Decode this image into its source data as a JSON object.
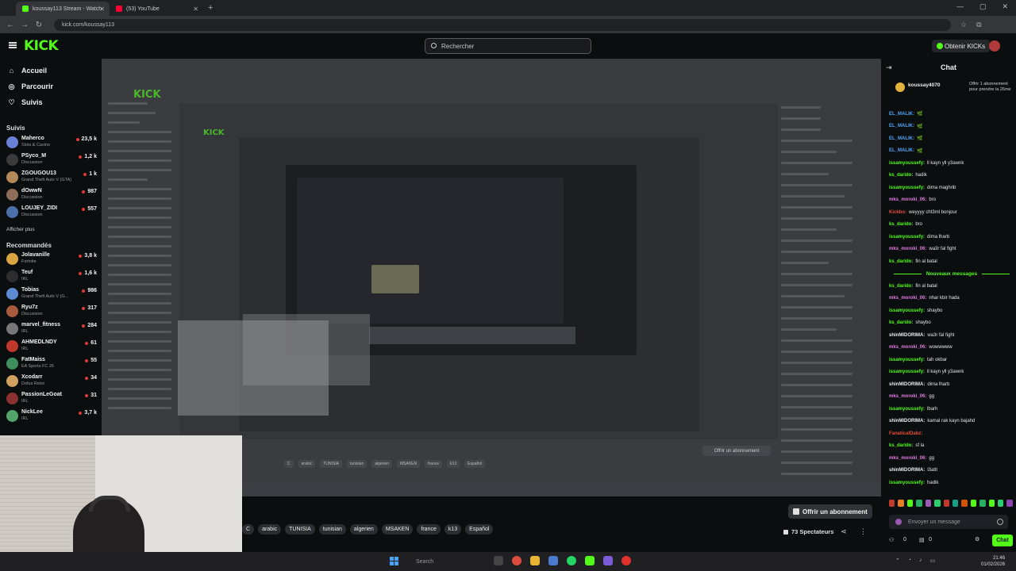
{
  "browser": {
    "tabs": [
      {
        "title": "koussay113 Stream - Watch",
        "favicon_color": "#53fc18",
        "active": true
      },
      {
        "title": "(53) YouTube",
        "favicon_color": "#ff0033",
        "active": false
      }
    ],
    "url": "kick.com/koussay113"
  },
  "header": {
    "logo": "KICK",
    "search_placeholder": "Rechercher",
    "kicks_button": "Obtenir KICKs"
  },
  "sidebar": {
    "nav": [
      {
        "label": "Accueil",
        "icon": "home-icon"
      },
      {
        "label": "Parcourir",
        "icon": "compass-icon"
      },
      {
        "label": "Suivis",
        "icon": "heart-icon"
      }
    ],
    "followed_title": "Suivis",
    "followed": [
      {
        "name": "Maherco",
        "category": "Slots & Casino",
        "viewers": "23,5 k",
        "color": "#6a7fd6"
      },
      {
        "name": "PSyco_M",
        "category": "Discussion",
        "viewers": "1,2 k",
        "color": "#3b3b3b"
      },
      {
        "name": "ZGOUGOU13",
        "category": "Grand Theft Auto V (GTA)",
        "viewers": "1 k",
        "color": "#b58a5a"
      },
      {
        "name": "dOwwN",
        "category": "Discussion",
        "viewers": "987",
        "color": "#8e6e58"
      },
      {
        "name": "LOUJEY_ZIDI",
        "category": "Discussion",
        "viewers": "557",
        "color": "#4b6fa8"
      }
    ],
    "show_more": "Afficher plus",
    "recommended_title": "Recommandés",
    "recommended": [
      {
        "name": "Jolavanille",
        "category": "Fortnite",
        "viewers": "3,8 k",
        "color": "#d9a441"
      },
      {
        "name": "Teuf",
        "category": "IRL",
        "viewers": "1,6 k",
        "color": "#2d2d2d"
      },
      {
        "name": "Tobias",
        "category": "Grand Theft Auto V (G...",
        "viewers": "986",
        "color": "#5d8bd1"
      },
      {
        "name": "Ryu7z",
        "category": "Discussion",
        "viewers": "317",
        "color": "#a85b3d"
      },
      {
        "name": "marvel_fitness",
        "category": "IRL",
        "viewers": "284",
        "color": "#777777"
      },
      {
        "name": "AHMEDLNDY",
        "category": "IRL",
        "viewers": "61",
        "color": "#c0392b"
      },
      {
        "name": "FatMaiss",
        "category": "EA Sports FC 26",
        "viewers": "55",
        "color": "#3f8f5e"
      },
      {
        "name": "Xcodarr",
        "category": "Dofus Retro",
        "viewers": "34",
        "color": "#d0a060"
      },
      {
        "name": "PassionLeGoat",
        "category": "IRL",
        "viewers": "31",
        "color": "#8a3030"
      },
      {
        "name": "NickLee",
        "category": "IRL",
        "viewers": "3,7 k",
        "color": "#52a46a"
      }
    ]
  },
  "stream": {
    "subscribe_button": "Offrir un abonnement",
    "tags": [
      "C",
      "arabic",
      "TUNISIA",
      "tunisian",
      "algerien",
      "MSAKEN",
      "france",
      "k13",
      "Español"
    ],
    "viewers": "73 Spectateurs"
  },
  "chat": {
    "title": "Chat",
    "pinned": {
      "user": "koussay4070",
      "message": "Offrir 1 abonnement pour prendre la 26me"
    },
    "messages": [
      {
        "user": "EL_MALIK:",
        "text": "🌿",
        "color": "#4fa3f7"
      },
      {
        "user": "EL_MALIK:",
        "text": "🌿",
        "color": "#4fa3f7"
      },
      {
        "user": "EL_MALIK:",
        "text": "🌿",
        "color": "#4fa3f7"
      },
      {
        "user": "EL_MALIK:",
        "text": "🌿",
        "color": "#4fa3f7"
      },
      {
        "user": "issamyoussefy:",
        "text": "ll kayn yll y3awnk",
        "color": "#53fc18"
      },
      {
        "user": "ks_darido:",
        "text": "hadik",
        "color": "#53fc18"
      },
      {
        "user": "issamyoussefy:",
        "text": "dima maghrib",
        "color": "#53fc18"
      },
      {
        "user": "mks_moroki_06:",
        "text": "bro",
        "color": "#e07be0"
      },
      {
        "user": "Kickbo:",
        "text": "weyyyy cht3ml bonjour",
        "color": "#e74c3c"
      },
      {
        "user": "ks_darido:",
        "text": "bro",
        "color": "#53fc18"
      },
      {
        "user": "issamyoussefy:",
        "text": "dima lharb",
        "color": "#53fc18"
      },
      {
        "user": "mks_moroki_06:",
        "text": "wa3r fal fight",
        "color": "#e07be0"
      },
      {
        "user": "ks_darido:",
        "text": "fin al batal",
        "color": "#53fc18"
      }
    ],
    "divider": "Nouveaux messages",
    "messages_after": [
      {
        "user": "ks_darido:",
        "text": "fin al batal",
        "color": "#53fc18"
      },
      {
        "user": "mks_moroki_06:",
        "text": "nhar kbir hada",
        "color": "#e07be0"
      },
      {
        "user": "issamyoussefy:",
        "text": "shaybo",
        "color": "#53fc18"
      },
      {
        "user": "ks_darido:",
        "text": "shaybo",
        "color": "#53fc18"
      },
      {
        "user": "shinMIDORIMA:",
        "text": "wa3r fal fight",
        "color": "#eaeaea"
      },
      {
        "user": "mks_moroki_06:",
        "text": "wowwwww",
        "color": "#e07be0"
      },
      {
        "user": "issamyoussefy:",
        "text": "tah okbar",
        "color": "#53fc18"
      },
      {
        "user": "issamyoussefy:",
        "text": "ll kayn yll y3awnk",
        "color": "#53fc18"
      },
      {
        "user": "shinMIDORIMA:",
        "text": "dima lharb",
        "color": "#eaeaea"
      },
      {
        "user": "mks_moroki_06:",
        "text": "gg",
        "color": "#e07be0"
      },
      {
        "user": "issamyoussefy:",
        "text": "lbarh",
        "color": "#53fc18"
      },
      {
        "user": "shinMIDORIMA:",
        "text": "kamal rak kayn bajahd",
        "color": "#eaeaea"
      },
      {
        "user": "FanaticalDabz:",
        "text": "",
        "color": "#e74c3c"
      },
      {
        "user": "ks_darido:",
        "text": "sf la",
        "color": "#53fc18"
      },
      {
        "user": "mks_moroki_06:",
        "text": "gg",
        "color": "#e07be0"
      },
      {
        "user": "shinMIDORIMA:",
        "text": "l3atit",
        "color": "#eaeaea"
      },
      {
        "user": "issamyoussefy:",
        "text": "hadik",
        "color": "#53fc18"
      }
    ],
    "input_placeholder": "Envoyer un message",
    "footer_left": "0",
    "footer_mid": "0",
    "send_button": "Chat"
  },
  "taskbar": {
    "search": "Search",
    "time": "21:46",
    "date": "01/02/2026"
  }
}
